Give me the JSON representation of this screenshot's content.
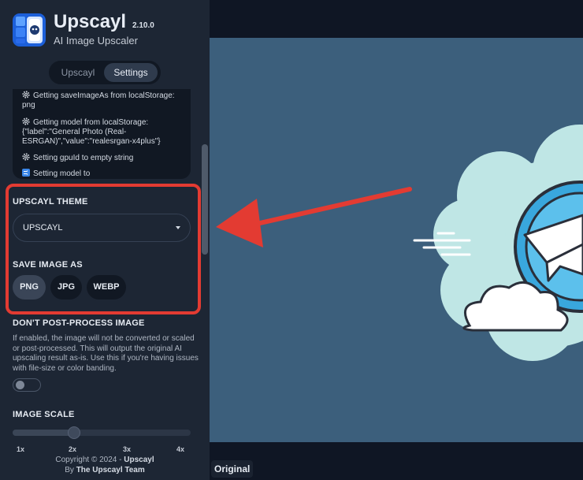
{
  "app": {
    "name": "Upscayl",
    "version": "2.10.0",
    "tagline": "AI Image Upscaler"
  },
  "tabs": [
    {
      "label": "Upscayl"
    },
    {
      "label": "Settings"
    }
  ],
  "log": [
    "Getting saveImageAs from localStorage: png",
    "Getting model from localStorage: {\"label\":\"General Photo (Real-ESRGAN)\",\"value\":\"realesrgan-x4plus\"}",
    "Setting gpuId to empty string",
    "Setting model to"
  ],
  "theme": {
    "label": "UPSCAYL THEME",
    "selected": "UPSCAYL"
  },
  "save_as": {
    "label": "SAVE IMAGE AS",
    "options": [
      "PNG",
      "JPG",
      "WEBP"
    ],
    "selected": "PNG"
  },
  "post_process": {
    "label": "DON'T POST-PROCESS IMAGE",
    "description": "If enabled, the image will not be converted or scaled or post-processed. This will output the original AI upscaling result as-is. Use this if you're having issues with file-size or color banding.",
    "enabled": false
  },
  "image_scale": {
    "label": "IMAGE SCALE",
    "ticks": [
      "1x",
      "2x",
      "3x",
      "4x"
    ],
    "value": "2x"
  },
  "footer": {
    "copyright_prefix": "Copyright © 2024 - ",
    "copyright_name": "Upscayl",
    "by_prefix": "By ",
    "by_name": "The Upscayl Team"
  },
  "preview": {
    "label": "Original"
  },
  "colors": {
    "accent_red": "#e33b32",
    "sidebar_bg": "#1d2634",
    "preview_bg": "#3c5f7c",
    "telegram_blue": "#39a7dd",
    "cloud": "#bfe6e5"
  },
  "icons": [
    "upscayl-logo-icon",
    "gear-icon",
    "shuffle-icon",
    "chevron-down-icon",
    "telegram-logo-icon",
    "red-arrow-icon"
  ]
}
